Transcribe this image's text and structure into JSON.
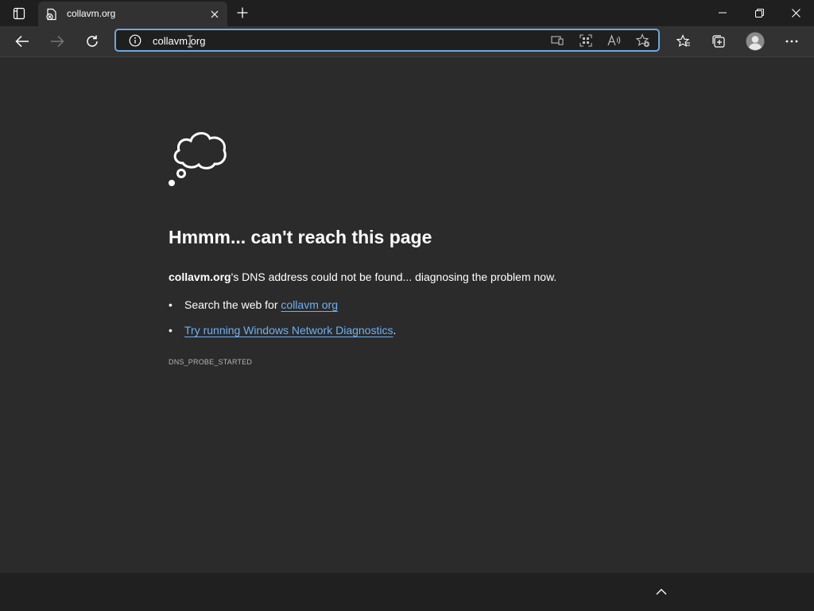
{
  "tab": {
    "title": "collavm.org",
    "icons": {
      "tab_actions": "vertical-tabs-icon",
      "favicon": "error-page-icon",
      "close": "close-icon",
      "new_tab": "plus-icon"
    }
  },
  "window_controls": [
    "minimize-icon",
    "restore-icon",
    "close-icon"
  ],
  "toolbar": {
    "icons": [
      "back-arrow-icon",
      "forward-arrow-icon",
      "refresh-icon"
    ],
    "right_icons": [
      "favorites-icon",
      "collections-icon",
      "profile-avatar-icon",
      "more-icon"
    ]
  },
  "address_bar": {
    "url": "collavm.org",
    "icons": [
      "site-info-icon",
      "app-available-icon",
      "qr-code-icon",
      "read-aloud-icon",
      "add-favorite-icon"
    ]
  },
  "error_page": {
    "icon": "thought-bubble-icon",
    "title": "Hmmm... can't reach this page",
    "message_host": "collavm.org",
    "message_rest": "'s DNS address could not be found... diagnosing the problem now.",
    "suggestions": [
      {
        "prefix": "Search the web for ",
        "link": "collavm org",
        "suffix": ""
      },
      {
        "prefix": "",
        "link": "Try running Windows Network Diagnostics",
        "suffix": "."
      }
    ],
    "error_code": "DNS_PROBE_STARTED"
  },
  "bottom_bar": {
    "icon": "chevron-up-icon"
  },
  "colors": {
    "page_background": "#2b2b2b",
    "tab_strip": "#1f1f1f",
    "toolbar": "#323232",
    "address_focus_border": "#6fa8dc",
    "link": "#6cb1f5",
    "bottom_bar": "#202020"
  }
}
